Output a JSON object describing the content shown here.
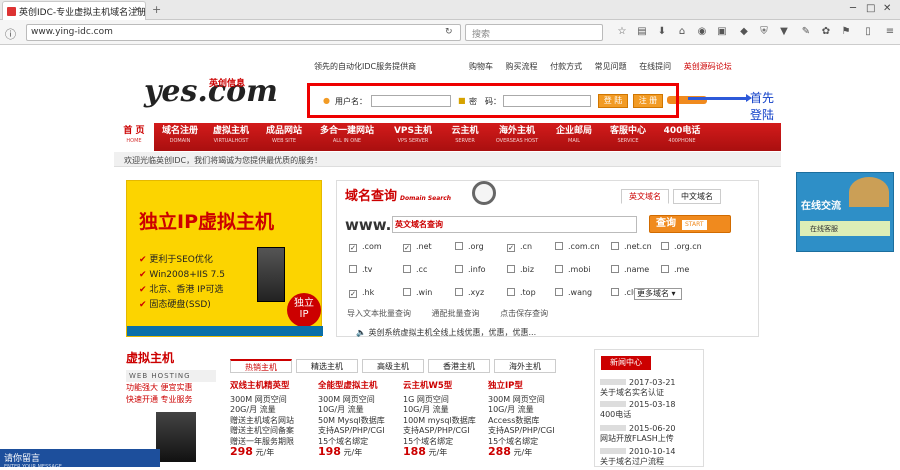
{
  "browser": {
    "tab_title": "英创IDC-专业虚拟主机域名注册...",
    "url": "www.ying-idc.com",
    "search_placeholder": "搜索"
  },
  "header": {
    "logo_text": "yes.com",
    "logo_cn": "英创信息",
    "slogan": "领先的自动化IDC服务提供商",
    "top_links": [
      "购物车",
      "购买流程",
      "付款方式",
      "常见问题",
      "在线提问",
      "英创源码论坛"
    ],
    "login": {
      "user_label": "用户名：",
      "pass_label": "密　码：",
      "login_button": "登 陆",
      "register_button": "注 册"
    }
  },
  "annotation": "首先登陆账户",
  "nav": {
    "items": [
      {
        "label": "首 页",
        "en": "HOME"
      },
      {
        "label": "域名注册",
        "en": "DOMAIN"
      },
      {
        "label": "虚拟主机",
        "en": "VIRTUALHOST"
      },
      {
        "label": "成品网站",
        "en": "WEB SITE"
      },
      {
        "label": "多合一建网站",
        "en": "ALL IN ONE"
      },
      {
        "label": "VPS主机",
        "en": "VPS SERVER"
      },
      {
        "label": "云主机",
        "en": "SERVER"
      },
      {
        "label": "海外主机",
        "en": "OVERSEAS HOST"
      },
      {
        "label": "企业邮局",
        "en": "MAIL"
      },
      {
        "label": "客服中心",
        "en": "SERVICE"
      },
      {
        "label": "400电话",
        "en": "400PHONE"
      }
    ],
    "welcome": "欢迎光临英创IDC，我们将竭诚为您提供最优质的服务！"
  },
  "promo": {
    "title": "独立IP虚拟主机",
    "features": [
      "更利于SEO优化",
      "Win2008+IIS 7.5",
      "北京、香港 IP可选",
      "固态硬盘(SSD)"
    ],
    "badge_line1": "独立",
    "badge_line2": "IP"
  },
  "domain": {
    "title": "域名查询",
    "title_en": "Domain Search",
    "tab_en": "英文域名",
    "tab_cn": "中文域名",
    "www": "www.",
    "input_value": "英文域名查询",
    "query_button": "查询",
    "start": "START",
    "tlds": [
      {
        "name": ".com",
        "checked": true
      },
      {
        "name": ".net",
        "checked": true
      },
      {
        "name": ".org",
        "checked": false
      },
      {
        "name": ".cn",
        "checked": true
      },
      {
        "name": ".com.cn",
        "checked": false
      },
      {
        "name": ".net.cn",
        "checked": false
      },
      {
        "name": ".org.cn",
        "checked": false
      },
      {
        "name": ".tv",
        "checked": false
      },
      {
        "name": ".cc",
        "checked": false
      },
      {
        "name": ".info",
        "checked": false
      },
      {
        "name": ".biz",
        "checked": false
      },
      {
        "name": ".mobi",
        "checked": false
      },
      {
        "name": ".name",
        "checked": false
      },
      {
        "name": ".me",
        "checked": false
      },
      {
        "name": ".hk",
        "checked": true
      },
      {
        "name": ".win",
        "checked": false
      },
      {
        "name": ".xyz",
        "checked": false
      },
      {
        "name": ".top",
        "checked": false
      },
      {
        "name": ".wang",
        "checked": false
      },
      {
        "name": ".club",
        "checked": false
      }
    ],
    "more_select": "更多域名",
    "bottom_links": [
      "导入文本批量查询",
      "通配批量查询",
      "点击保存查询"
    ],
    "news_ticker": "英创系统虚拟主机全线上线优惠，优惠，优惠..."
  },
  "hosting": {
    "title": "虚拟主机",
    "subtitle": "WEB HOSTING",
    "taglines": [
      "功能强大 便宜实惠",
      "快速开通 专业服务"
    ],
    "tabs": [
      "热销主机",
      "精选主机",
      "高级主机",
      "香港主机",
      "海外主机"
    ],
    "plans": [
      {
        "name": "双线主机精英型",
        "lines": [
          "300M 网页空间",
          "20G/月 流量",
          "赠送主机域名网站",
          "赠送主机空间备案",
          "赠送一年服务期限"
        ],
        "price": "298",
        "unit": "元/年"
      },
      {
        "name": "全能型虚拟主机",
        "lines": [
          "300M 网页空间",
          "10G/月 流量",
          "50M Mysql数据库",
          "支持ASP/PHP/CGI",
          "15个域名绑定"
        ],
        "price": "198",
        "unit": "元/年"
      },
      {
        "name": "云主机W5型",
        "lines": [
          "1G 网页空间",
          "10G/月 流量",
          "100M mysql数据库",
          "支持ASP/PHP/CGI",
          "15个域名绑定"
        ],
        "price": "188",
        "unit": "元/年"
      },
      {
        "name": "独立IP型",
        "lines": [
          "300M 网页空间",
          "10G/月 流量",
          "Access数据库",
          "支持ASP/PHP/CGI",
          "15个域名绑定"
        ],
        "price": "288",
        "unit": "元/年"
      }
    ]
  },
  "news": {
    "title": "新闻中心",
    "items": [
      {
        "date": "2017-03-21",
        "title": "关于域名实名认证"
      },
      {
        "date": "2015-03-18",
        "title": "400电话"
      },
      {
        "date": "2015-06-20",
        "title": "网站开放FLASH上传"
      },
      {
        "date": "2010-10-14",
        "title": "关于域名过户流程"
      }
    ]
  },
  "chat": {
    "title": "在线交流",
    "subtitle": "在线客服"
  },
  "taskbar": {
    "label": "请你留言",
    "sub": "ENTER YOUR MESSAGE"
  }
}
